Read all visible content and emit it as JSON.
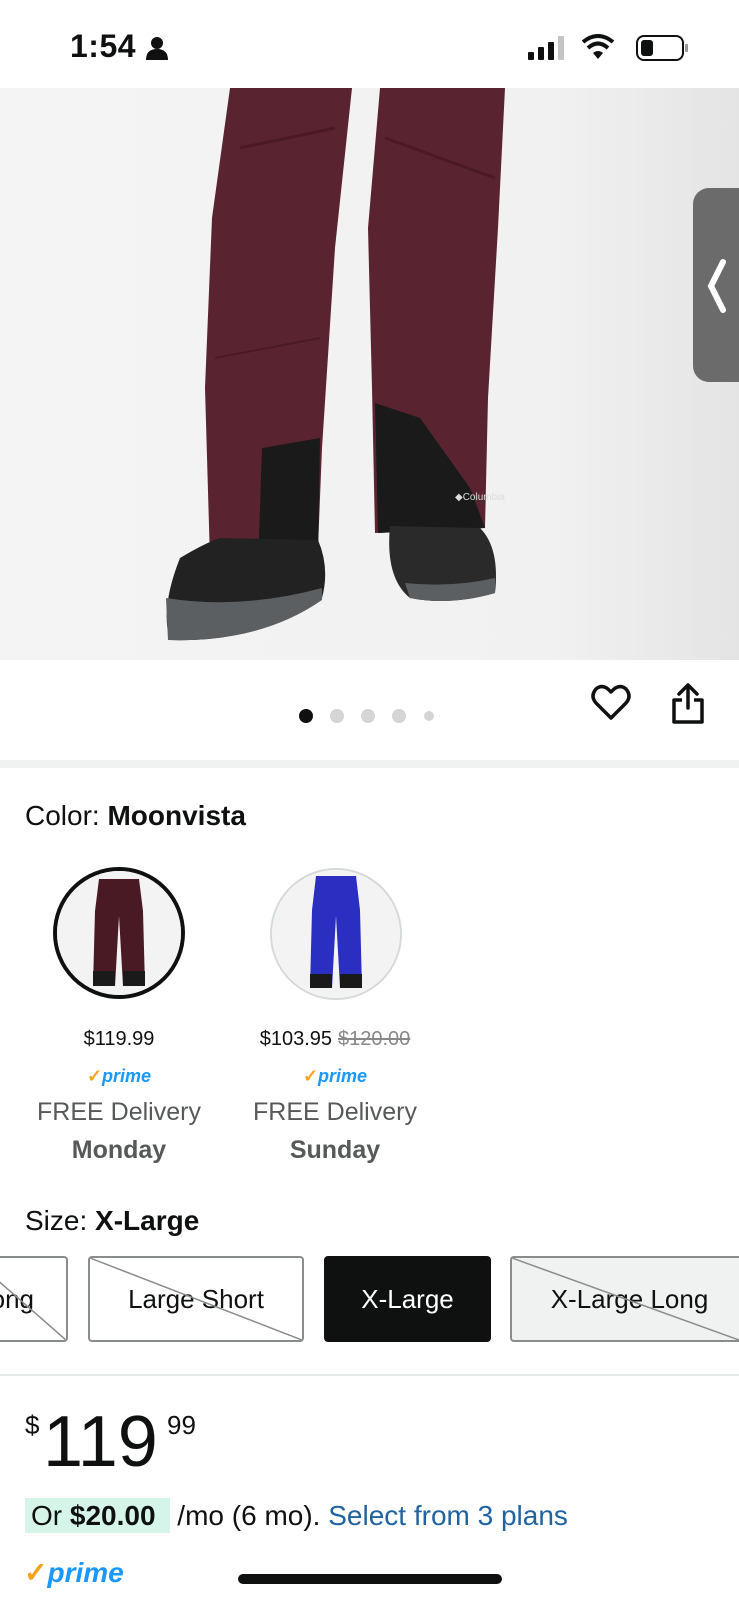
{
  "status_bar": {
    "time": "1:54"
  },
  "product": {
    "carousel_dots": 5,
    "active_dot": 0
  },
  "color": {
    "label": "Color: ",
    "selected": "Moonvista",
    "options": [
      {
        "price": "$119.99",
        "old_price": "",
        "prime": "prime",
        "delivery": "FREE Delivery",
        "day": "Monday",
        "swatch_color": "#4a1a24"
      },
      {
        "price": "$103.95",
        "old_price": "$120.00",
        "prime": "prime",
        "delivery": "FREE Delivery",
        "day": "Sunday",
        "swatch_color": "#2a2fc2"
      }
    ]
  },
  "size": {
    "label": "Size: ",
    "selected": "X-Large",
    "options": [
      {
        "label": "ong",
        "state": "disabled"
      },
      {
        "label": "Large Short",
        "state": "disabled"
      },
      {
        "label": "X-Large",
        "state": "selected"
      },
      {
        "label": "X-Large Long",
        "state": "disabled"
      }
    ]
  },
  "price": {
    "symbol": "$",
    "whole": "119",
    "fraction": "99"
  },
  "financing": {
    "prefix": "Or ",
    "amount": "$20.00",
    "terms": " /mo (6 mo). ",
    "link": "Select from 3 plans"
  },
  "prime_badge": "prime",
  "colors": {
    "product_maroon": "#5a2330",
    "prime_blue": "#1a98ff",
    "prime_check": "#f7a21b",
    "link_blue": "#2162a1"
  }
}
